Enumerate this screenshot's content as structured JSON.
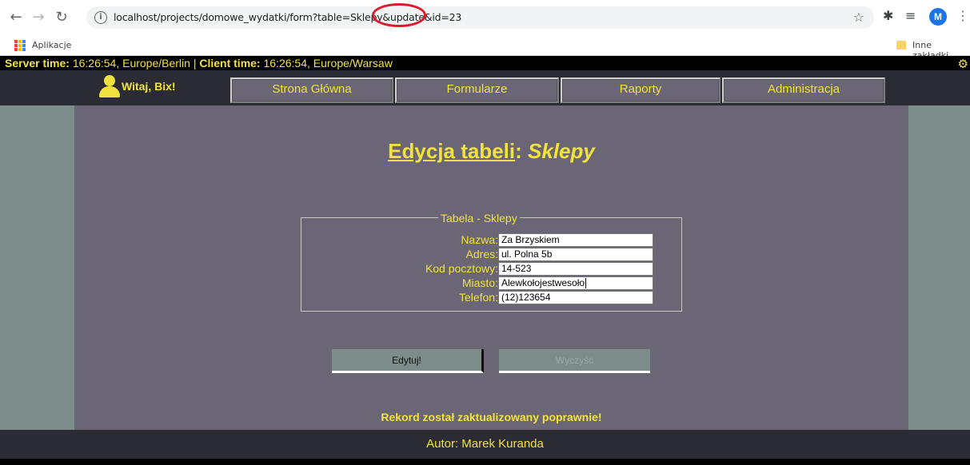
{
  "browser": {
    "url": "localhost/projects/domowe_wydatki/form?table=Sklepy&update&id=23",
    "bookmarks": {
      "apps_label": "Aplikacje",
      "other_label": "Inne zakładki"
    },
    "profile_initial": "M"
  },
  "timebar": {
    "server_label": "Server time:",
    "server_value": "16:26:54, Europe/Berlin",
    "separator": "|",
    "client_label": "Client time:",
    "client_value": "16:26:54, Europe/Warsaw"
  },
  "menu": {
    "greeting": "Witaj, Bix!",
    "items": [
      {
        "label": "Strona Główna"
      },
      {
        "label": "Formularze"
      },
      {
        "label": "Raporty"
      },
      {
        "label": "Administracja"
      }
    ]
  },
  "page": {
    "title_prefix": "Edycja tabeli",
    "title_colon": ":",
    "title_table": "Sklepy",
    "legend": "Tabela - Sklepy",
    "fields": [
      {
        "label": "Nazwa:",
        "value": "Za Brzyskiem"
      },
      {
        "label": "Adres:",
        "value": "ul. Polna 5b"
      },
      {
        "label": "Kod pocztowy:",
        "value": "14-523"
      },
      {
        "label": "Miasto:",
        "value": "Alewkołojestwesoło"
      },
      {
        "label": "Telefon:",
        "value": "(12)123654"
      }
    ],
    "edit_button": "Edytuj!",
    "clear_button": "Wyczyść",
    "message": "Rekord został zaktualizowany poprawnie!"
  },
  "footer": {
    "author": "Autor: Marek Kuranda"
  },
  "colors": {
    "accent": "#f2e23d",
    "content_bg": "#6a6675",
    "side_bg": "#7b8c89",
    "bar_bg": "#2b2b33"
  }
}
